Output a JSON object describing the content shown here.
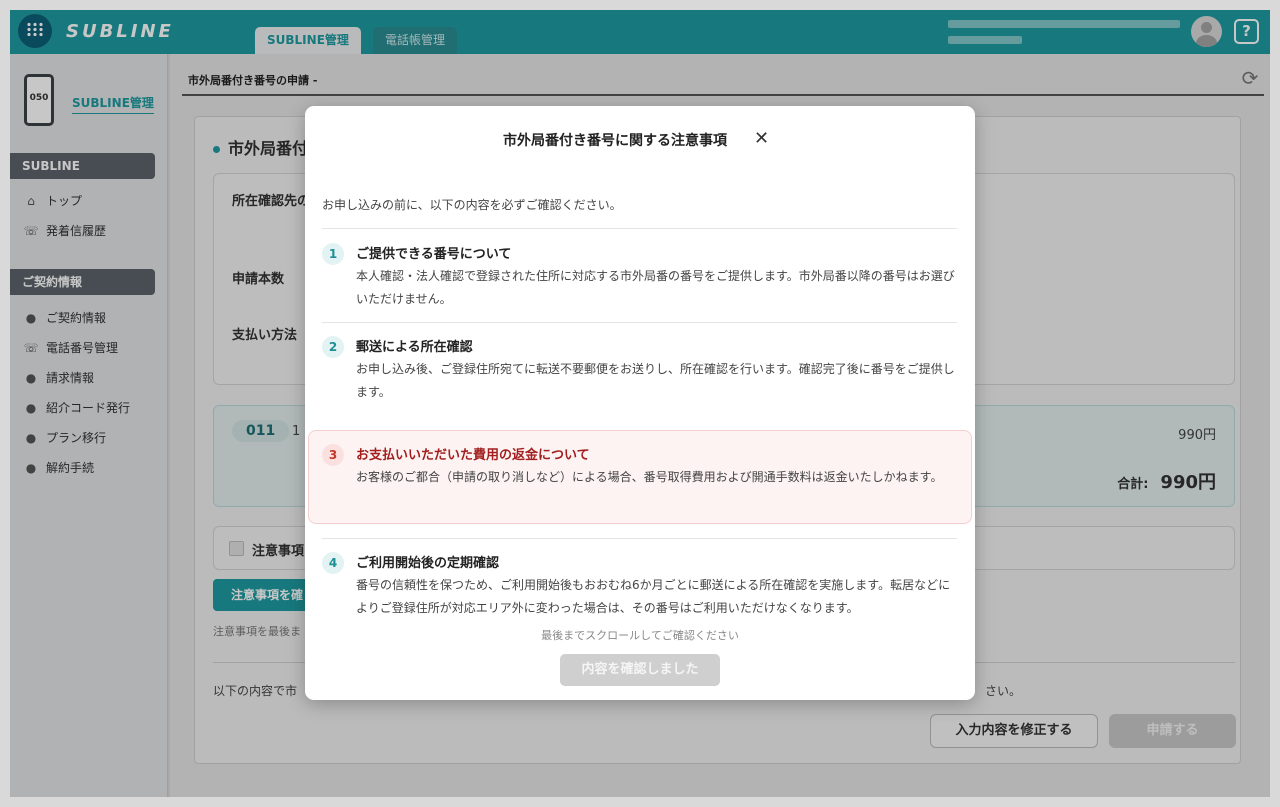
{
  "header": {
    "logo_text": "SUBLINE",
    "tabs": [
      {
        "label": "SUBLINE管理",
        "active": true
      },
      {
        "label": "電話帳管理",
        "active": false
      }
    ],
    "help_label": "?"
  },
  "sidebar": {
    "phone_number_label": "050",
    "title": "SUBLINE管理",
    "sections": [
      {
        "label": "SUBLINE",
        "items": [
          {
            "label": "トップ",
            "icon": "home-icon"
          },
          {
            "label": "発着信履歴",
            "icon": "phone-history-icon"
          }
        ]
      },
      {
        "label": "ご契約情報",
        "items": [
          {
            "label": "ご契約情報",
            "icon": "bubble-icon"
          },
          {
            "label": "電話番号管理",
            "icon": "phone-icon"
          },
          {
            "label": "請求情報",
            "icon": "bubble-icon"
          },
          {
            "label": "紹介コード発行",
            "icon": "bubble-icon"
          },
          {
            "label": "プラン移行",
            "icon": "bubble-icon"
          },
          {
            "label": "解約手続",
            "icon": "bubble-icon"
          }
        ]
      }
    ]
  },
  "main": {
    "breadcrumb": "市外局番付き番号の申請 -",
    "section_title": "市外局番付",
    "labels": {
      "address_confirm": "所在確認先の",
      "count": "申請本数",
      "payment": "支払い方法"
    },
    "summary": {
      "code": "011",
      "qty": "1",
      "price": "990円",
      "total_label": "合計:",
      "total_value": "990円"
    },
    "notice_label": "注意事項",
    "notice_button": "注意事項を確",
    "notice_note": "注意事項を最後ま",
    "bottom_text_left": "以下の内容で市",
    "bottom_text_right": "さい。",
    "edit_button": "入力内容を修正する",
    "apply_button": "申請する"
  },
  "modal": {
    "title": "市外局番付き番号に関する注意事項",
    "close_label": "✕",
    "intro": "お申し込みの前に、以下の内容を必ずご確認ください。",
    "items": [
      {
        "num": "1",
        "title": "ご提供できる番号について",
        "body": "本人確認・法人確認で登録された住所に対応する市外局番の番号をご提供します。市外局番以降の番号はお選びいただけません。"
      },
      {
        "num": "2",
        "title": "郵送による所在確認",
        "body": "お申し込み後、ご登録住所宛てに転送不要郵便をお送りし、所在確認を行います。確認完了後に番号をご提供します。"
      },
      {
        "num": "3",
        "title": "お支払いいただいた費用の返金について",
        "body": "お客様のご都合（申請の取り消しなど）による場合、番号取得費用および開通手数料は返金いたしかねます。"
      },
      {
        "num": "4",
        "title": "ご利用開始後の定期確認",
        "body": "番号の信頼性を保つため、ご利用開始後もおおむね6か月ごとに郵送による所在確認を実施します。転居などによりご登録住所が対応エリア外に変わった場合は、その番号はご利用いただけなくなります。"
      }
    ],
    "scroll_hint": "最後までスクロールしてご確認ください",
    "confirm_button": "内容を確認しました"
  },
  "colors": {
    "accent": "#1e9ba1",
    "warning": "#a31f1f",
    "sidebar_section": "#5b636a"
  }
}
